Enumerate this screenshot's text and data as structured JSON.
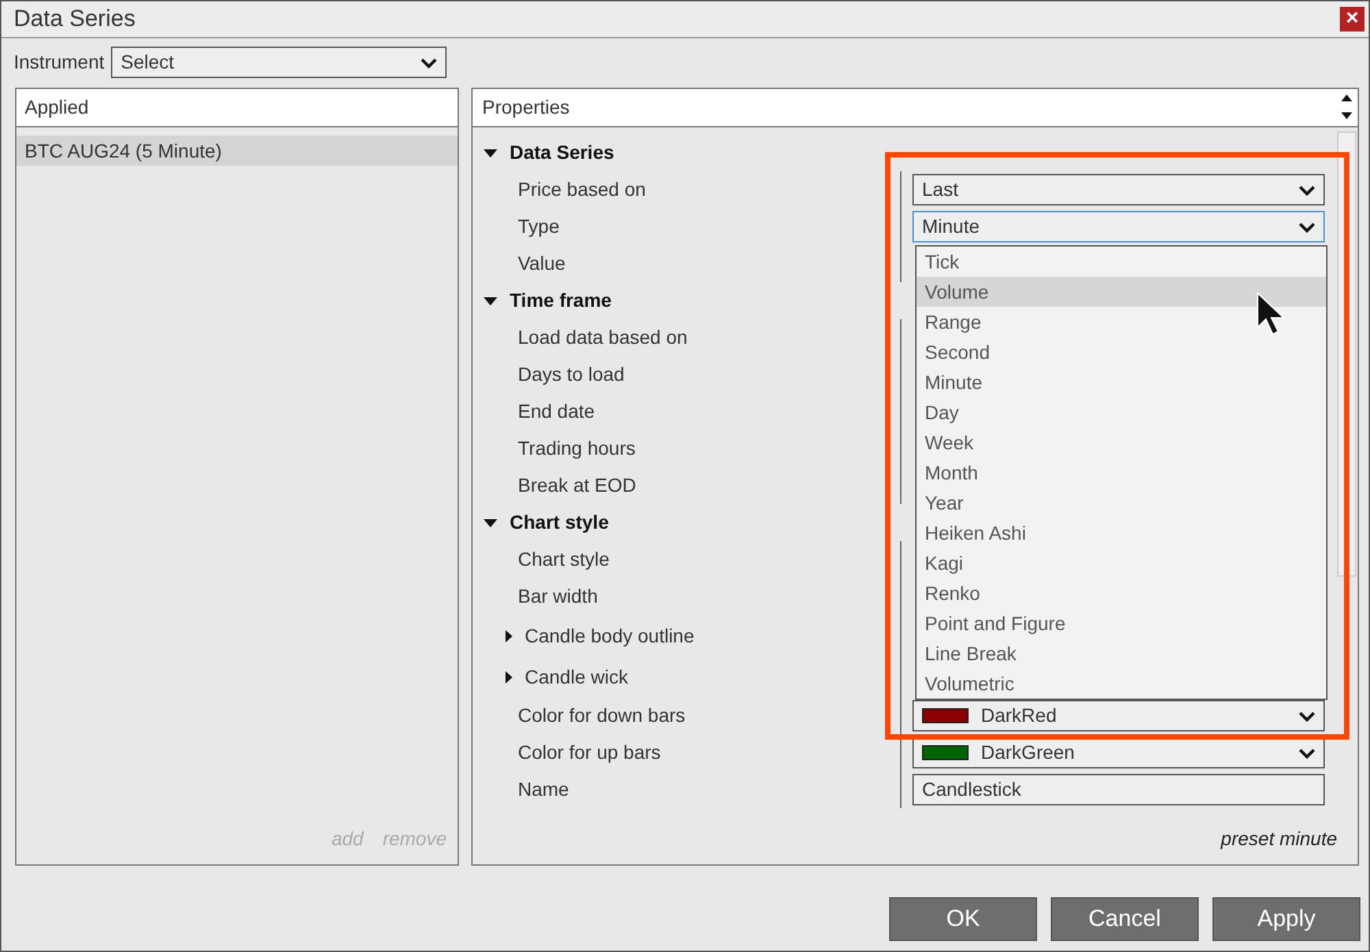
{
  "window": {
    "title": "Data Series",
    "close": "×"
  },
  "instrument": {
    "label": "Instrument",
    "value": "Select"
  },
  "applied": {
    "header": "Applied",
    "items": [
      {
        "label": "BTC AUG24 (5 Minute)",
        "selected": true
      }
    ],
    "actions": [
      "add",
      "remove"
    ]
  },
  "properties": {
    "header": "Properties",
    "groups": [
      {
        "label": "Data Series",
        "expanded": true,
        "children": [
          {
            "label": "Price based on",
            "kind": "dropdown",
            "value": "Last",
            "focused": false
          },
          {
            "label": "Type",
            "kind": "dropdown",
            "value": "Minute",
            "focused": true
          },
          {
            "label": "Value",
            "kind": "hidden"
          }
        ]
      },
      {
        "label": "Time frame",
        "expanded": true,
        "children": [
          {
            "label": "Load data based on",
            "kind": "hidden"
          },
          {
            "label": "Days to load",
            "kind": "hidden"
          },
          {
            "label": "End date",
            "kind": "hidden"
          },
          {
            "label": "Trading hours",
            "kind": "hidden"
          },
          {
            "label": "Break at EOD",
            "kind": "hidden"
          }
        ]
      },
      {
        "label": "Chart style",
        "expanded": true,
        "children": [
          {
            "label": "Chart style",
            "kind": "hidden"
          },
          {
            "label": "Bar width",
            "kind": "hidden"
          },
          {
            "label": "Candle body outline",
            "kind": "group",
            "expanded": false
          },
          {
            "label": "Candle wick",
            "kind": "group",
            "expanded": false
          },
          {
            "label": "Color for down bars",
            "kind": "color",
            "value": "DarkRed",
            "color": "#8b0000"
          },
          {
            "label": "Color for up bars",
            "kind": "color",
            "value": "DarkGreen",
            "color": "#006400"
          },
          {
            "label": "Name",
            "kind": "text",
            "value": "Candlestick"
          }
        ]
      }
    ],
    "preset": "preset minute"
  },
  "dropdown": {
    "options": [
      {
        "label": "Tick",
        "selected": false
      },
      {
        "label": "Volume",
        "selected": true
      },
      {
        "label": "Range",
        "selected": false
      },
      {
        "label": "Second",
        "selected": false
      },
      {
        "label": "Minute",
        "selected": false
      },
      {
        "label": "Day",
        "selected": false
      },
      {
        "label": "Week",
        "selected": false
      },
      {
        "label": "Month",
        "selected": false
      },
      {
        "label": "Year",
        "selected": false
      },
      {
        "label": "Heiken Ashi",
        "selected": false
      },
      {
        "label": "Kagi",
        "selected": false
      },
      {
        "label": "Renko",
        "selected": false
      },
      {
        "label": "Point and Figure",
        "selected": false
      },
      {
        "label": "Line Break",
        "selected": false
      },
      {
        "label": "Volumetric",
        "selected": false
      }
    ]
  },
  "buttons": [
    "OK",
    "Cancel",
    "Apply"
  ]
}
